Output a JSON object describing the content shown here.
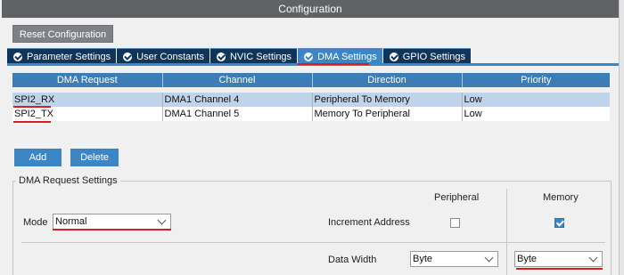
{
  "window": {
    "title": "Configuration"
  },
  "toolbar": {
    "reset_label": "Reset Configuration"
  },
  "tabs": [
    {
      "label": "Parameter Settings",
      "active": false
    },
    {
      "label": "User Constants",
      "active": false
    },
    {
      "label": "NVIC Settings",
      "active": false
    },
    {
      "label": "DMA Settings",
      "active": true
    },
    {
      "label": "GPIO Settings",
      "active": false
    }
  ],
  "table": {
    "headers": [
      "DMA Request",
      "Channel",
      "Direction",
      "Priority"
    ],
    "rows": [
      {
        "request": "SPI2_RX",
        "channel": "DMA1 Channel 4",
        "direction": "Peripheral To Memory",
        "priority": "Low",
        "selected": true
      },
      {
        "request": "SPI2_TX",
        "channel": "DMA1 Channel 5",
        "direction": "Memory To Peripheral",
        "priority": "Low",
        "selected": false
      }
    ]
  },
  "actions": {
    "add_label": "Add",
    "delete_label": "Delete"
  },
  "settings": {
    "group_title": "DMA Request Settings",
    "peripheral_header": "Peripheral",
    "memory_header": "Memory",
    "mode_label": "Mode",
    "mode_value": "Normal",
    "increment_label": "Increment Address",
    "increment_peripheral": false,
    "increment_memory": true,
    "data_width_label": "Data Width",
    "peripheral_width": "Byte",
    "memory_width": "Byte"
  },
  "colors": {
    "titlebar": "#606266",
    "tab": "#10355a",
    "tab_active": "#3c86c5",
    "table_header": "#3d7db6",
    "selected_row": "#bfd4ea",
    "highlight": "#d32020"
  },
  "icons": {
    "tab_status": "check-circle-icon",
    "dropdown": "chevron-down-icon",
    "checkbox": "checkbox-icon"
  }
}
